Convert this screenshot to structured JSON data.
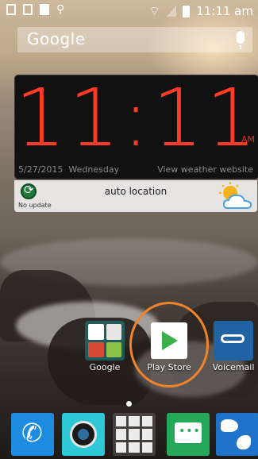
{
  "status_bar": {
    "time": "11:11 am",
    "icons": [
      "download-icon",
      "image-icon",
      "barcode-icon",
      "usb-icon",
      "wifi-icon",
      "signal-icon",
      "battery-icon"
    ]
  },
  "search": {
    "label": "Google",
    "icon": "mic-icon"
  },
  "clock_widget": {
    "time": "11:11",
    "ampm": "AM",
    "date": "5/27/2015",
    "day": "Wednesday",
    "link": "View weather website",
    "color": "#ff3b28"
  },
  "weather": {
    "status": "No update",
    "location": "auto location",
    "icon": "partly-cloudy-icon"
  },
  "home_apps": [
    {
      "label": "Google",
      "icon": "google-folder-icon"
    },
    {
      "label": "Play Store",
      "icon": "play-store-icon",
      "highlight_color": "#f0842c"
    },
    {
      "label": "Voicemail",
      "icon": "voicemail-icon"
    }
  ],
  "dock": [
    "phone-icon",
    "camera-icon",
    "app-drawer-icon",
    "messaging-icon",
    "browser-icon"
  ]
}
